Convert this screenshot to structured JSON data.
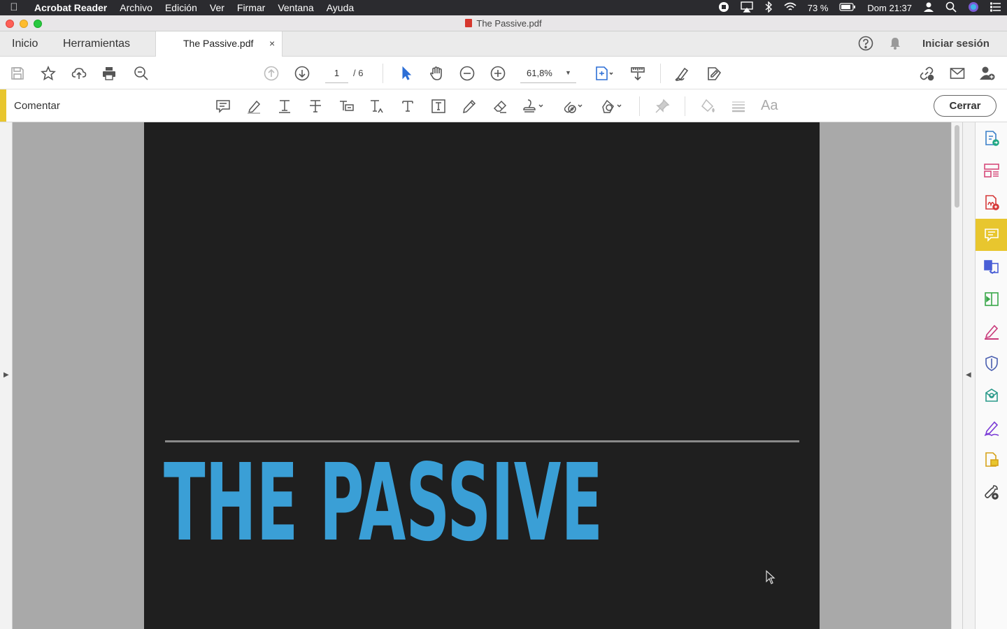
{
  "menubar": {
    "app_name": "Acrobat Reader",
    "menus": [
      "Archivo",
      "Edición",
      "Ver",
      "Firmar",
      "Ventana",
      "Ayuda"
    ],
    "battery": "73 %",
    "clock": "Dom 21:37"
  },
  "window": {
    "title": "The Passive.pdf"
  },
  "tabs": {
    "home": "Inicio",
    "tools": "Herramientas",
    "document": "The Passive.pdf",
    "close": "×",
    "sign_in": "Iniciar sesión"
  },
  "toolbar": {
    "current_page": "1",
    "total_pages": "/ 6",
    "zoom": "61,8%"
  },
  "comment_toolbar": {
    "label": "Comentar",
    "close_button": "Cerrar",
    "text_style": "Aa"
  },
  "document": {
    "heading": "THE PASSIVE"
  },
  "colors": {
    "accent_yellow": "#e8c62e",
    "heading_blue": "#3a9fd6",
    "page_bg": "#1f1f1f"
  }
}
